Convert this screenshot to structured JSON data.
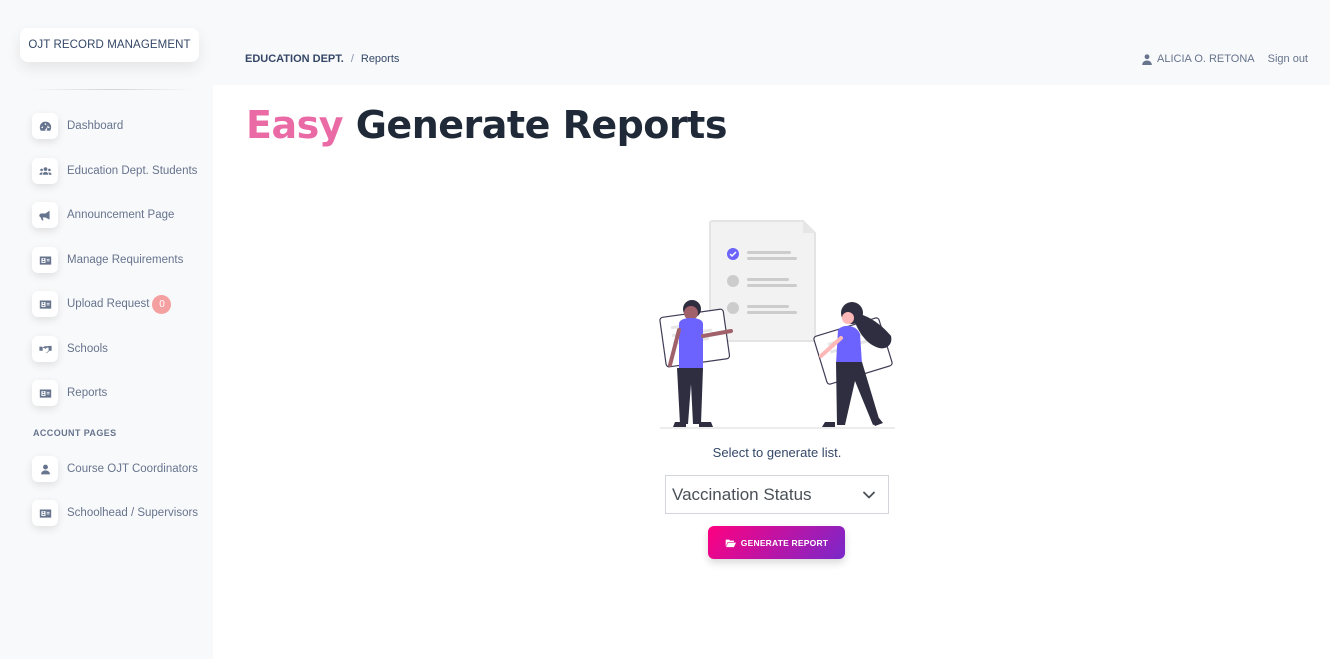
{
  "sidebar": {
    "brand": "OJT RECORD MANAGEMENT",
    "items": [
      {
        "label": "Dashboard",
        "icon": "dashboard-gauge-icon"
      },
      {
        "label": "Education Dept. Students",
        "icon": "users-icon"
      },
      {
        "label": "Announcement Page",
        "icon": "megaphone-icon"
      },
      {
        "label": "Manage Requirements",
        "icon": "id-card-icon"
      },
      {
        "label": "Upload Request",
        "icon": "id-card-icon",
        "badge": "0"
      },
      {
        "label": "Schools",
        "icon": "handshake-icon"
      },
      {
        "label": "Reports",
        "icon": "id-card-icon"
      }
    ],
    "account_heading": "ACCOUNT PAGES",
    "account_items": [
      {
        "label": "Course OJT Coordinators",
        "icon": "user-icon"
      },
      {
        "label": "Schoolhead / Supervisors",
        "icon": "id-card-icon"
      }
    ]
  },
  "header": {
    "breadcrumb_root": "EDUCATION DEPT.",
    "breadcrumb_sep": "/",
    "breadcrumb_current": "Reports",
    "user_name": "ALICIA O. RETONA",
    "signout_label": "Sign out"
  },
  "main": {
    "title_accent": "Easy",
    "title_rest": "Generate Reports",
    "select_label": "Select to generate list.",
    "selected_option": "Vaccination Status",
    "button_label": "GENERATE REPORT"
  },
  "colors": {
    "accent_pink": "#ea6aa6",
    "button_gradient_start": "#ff0080",
    "button_gradient_end": "#7928ca",
    "illustration_purple": "#6c63ff",
    "badge": "#f4a0a0"
  }
}
